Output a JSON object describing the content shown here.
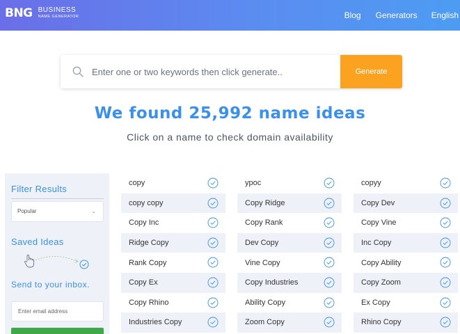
{
  "header": {
    "logo_mark": "BNG",
    "logo_line1": "BUSINESS",
    "logo_line2": "NAME GENERATOR",
    "nav": [
      "Blog",
      "Generators",
      "English"
    ]
  },
  "search": {
    "placeholder": "Enter one or two keywords then click generate..",
    "button": "Generate"
  },
  "results_heading": "We found 25,992 name ideas",
  "results_subheading": "Click on a name to check domain availability",
  "sidebar": {
    "filter_title": "Filter Results",
    "filter_value": "Popular",
    "saved_title": "Saved Ideas",
    "send_title": "Send to your inbox.",
    "email_placeholder": "Enter email address"
  },
  "columns": [
    [
      "copy",
      "copy copy",
      "Copy Inc",
      "Ridge Copy",
      "Rank Copy",
      "Copy Ex",
      "Copy Rhino",
      "Industries Copy"
    ],
    [
      "ypoc",
      "Copy Ridge",
      "Copy Rank",
      "Dev Copy",
      "Vine Copy",
      "Copy Industries",
      "Ability Copy",
      "Zoom Copy"
    ],
    [
      "copyy",
      "Copy Dev",
      "Copy Vine",
      "Inc Copy",
      "Copy Ability",
      "Copy Zoom",
      "Ex Copy",
      "Rhino Copy"
    ]
  ],
  "colors": {
    "accent_blue": "#3b91ea",
    "generate_orange": "#fba321",
    "row_alt": "#eef1f8",
    "sidebar_bg": "#eef1f8",
    "send_green": "#3ea84a"
  },
  "icons": {
    "search": "search-icon",
    "check": "check-circle-icon",
    "hand": "hand-pointer-icon",
    "chevron": "chevron-down-icon"
  }
}
